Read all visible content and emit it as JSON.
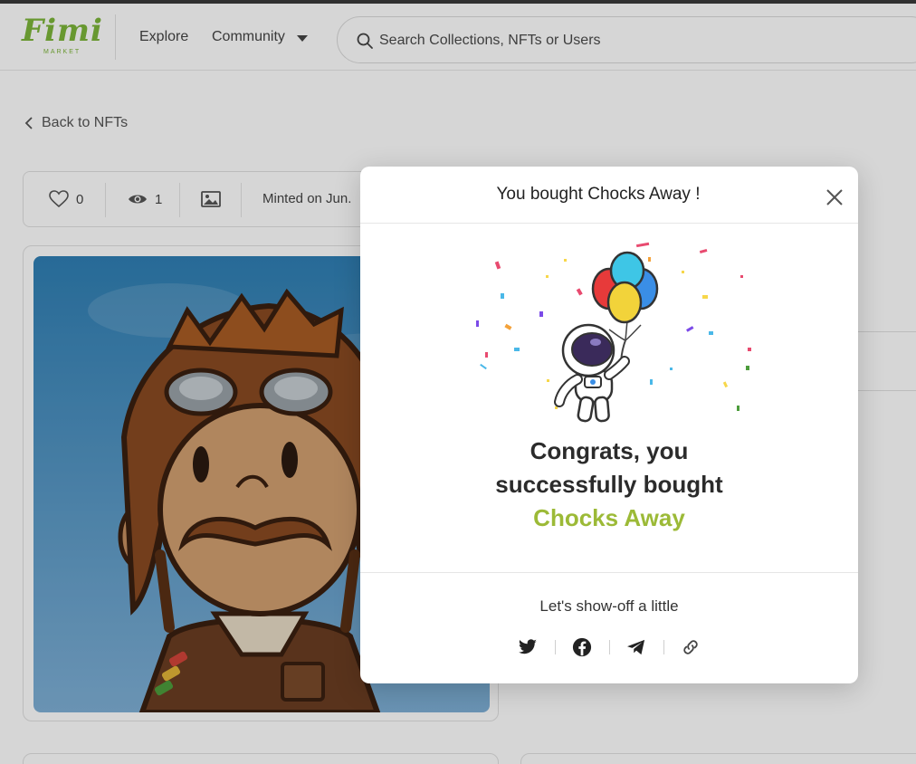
{
  "header": {
    "logo_text": "Fimi",
    "logo_sub": "MARKET",
    "nav": {
      "explore": "Explore",
      "community": "Community"
    },
    "search_placeholder": "Search Collections, NFTs or Users"
  },
  "page": {
    "back_label": "Back to NFTs",
    "stats": {
      "likes": "0",
      "views": "1",
      "minted": "Minted on Jun."
    }
  },
  "modal": {
    "title": "You bought Chocks Away !",
    "congrats_line1": "Congrats, you",
    "congrats_line2": "successfully bought",
    "item_name": "Chocks Away",
    "showoff": "Let's show-off a little",
    "share_icons": [
      "twitter-icon",
      "facebook-icon",
      "telegram-icon",
      "link-icon"
    ]
  },
  "colors": {
    "brand_green": "#7db53a",
    "item_green": "#9cba37",
    "overlay": "rgba(0,0,0,0.16)"
  }
}
